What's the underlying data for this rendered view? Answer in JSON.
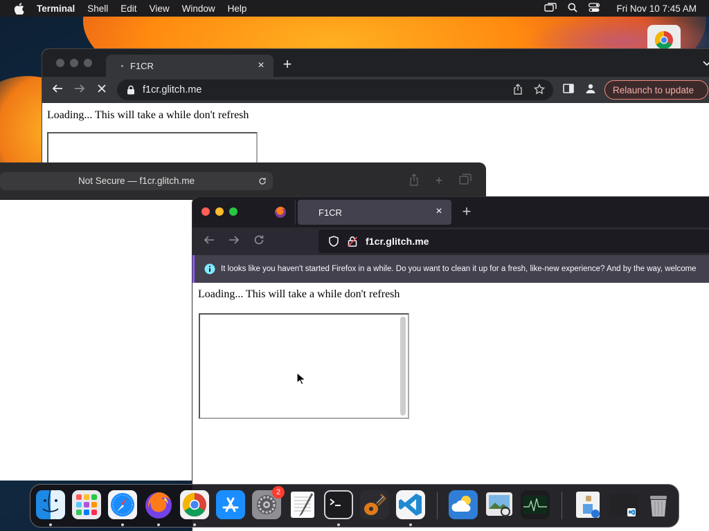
{
  "menubar": {
    "app_name": "Terminal",
    "menus": [
      "Shell",
      "Edit",
      "View",
      "Window",
      "Help"
    ],
    "clock": "Fri Nov 10  7:45 AM"
  },
  "chrome": {
    "tab_title": "F1CR",
    "url": "f1cr.glitch.me",
    "relaunch_label": "Relaunch to update",
    "page_text": "Loading... This will take a while don't refresh"
  },
  "safari": {
    "address_text": "Not Secure — f1cr.glitch.me"
  },
  "firefox": {
    "tab_title": "F1CR",
    "url": "f1cr.glitch.me",
    "notice_text": "It looks like you haven't started Firefox in a while. Do you want to clean it up for a fresh, like-new experience? And by the way, welcome",
    "page_text": "Loading... This will take a while don't refresh"
  },
  "dock": {
    "apps": [
      "finder",
      "launchpad",
      "safari",
      "firefox",
      "chrome",
      "app-store",
      "system-settings",
      "textedit",
      "terminal",
      "instruments",
      "vscode",
      "weather",
      "preview",
      "activity-monitor",
      "downloads",
      "window-stack",
      "trash"
    ],
    "system_settings_badge": "2"
  },
  "colors": {
    "chrome_relaunch": "#f28b82",
    "firefox_accent": "#9059ff",
    "badge": "#ff3b30"
  }
}
